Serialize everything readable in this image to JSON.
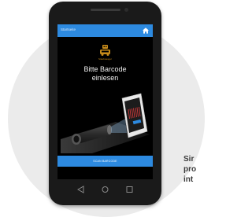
{
  "side_text": [
    "Sir",
    "pro",
    "int"
  ],
  "app": {
    "appbar_title": "Startseite",
    "home_icon": "home-icon",
    "logo_icon": "robot-vacuum-icon",
    "logo_caption": "Staubsauger",
    "heading_line1": "Bitte Barcode",
    "heading_line2": "einlesen",
    "scan_button_label": "SCAN BARCODE"
  },
  "colors": {
    "accent": "#2d8ae0",
    "logo": "#c78b1a",
    "background_circle": "#ebebeb"
  }
}
